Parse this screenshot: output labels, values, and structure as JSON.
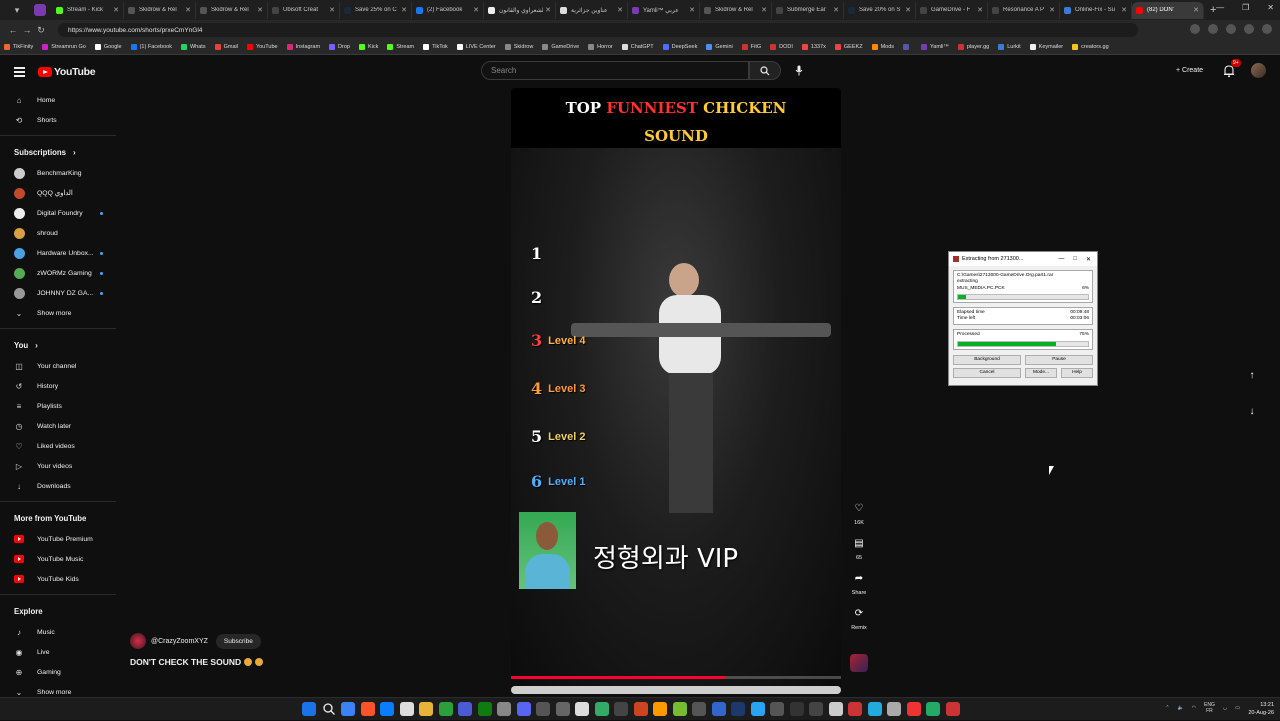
{
  "browser": {
    "tabs": [
      {
        "title": "Stream - Kick",
        "fav": "#53fc18"
      },
      {
        "title": "Skidrow & Rel",
        "fav": "#555"
      },
      {
        "title": "Skidrow & Rel",
        "fav": "#555"
      },
      {
        "title": "Ubisoft Creat",
        "fav": "#444"
      },
      {
        "title": "Save 25% on C",
        "fav": "#1b2838"
      },
      {
        "title": "(2) Facebook",
        "fav": "#1877f2"
      },
      {
        "title": "الشعراوي والقانون",
        "fav": "#eee"
      },
      {
        "title": "عناوين جزائرية",
        "fav": "#ddd"
      },
      {
        "title": "Yamli™ عربي",
        "fav": "#7a3bb0"
      },
      {
        "title": "Skidrow & Rel",
        "fav": "#555"
      },
      {
        "title": "Submerge Ear",
        "fav": "#444"
      },
      {
        "title": "Save 20% on S",
        "fav": "#1b2838"
      },
      {
        "title": "GameDrive - F",
        "fav": "#444"
      },
      {
        "title": "Resonance A P",
        "fav": "#444"
      },
      {
        "title": "Online-Fix - Su",
        "fav": "#3a7bd5"
      },
      {
        "title": "(82) DON'",
        "fav": "#ff0000",
        "active": true
      }
    ],
    "url": "https://www.youtube.com/shorts/prxeCmYnGl4",
    "bookmarks": [
      {
        "label": "TikFinity",
        "color": "#e63"
      },
      {
        "label": "Streamrun Go",
        "color": "#c2c"
      },
      {
        "label": "Google",
        "color": "#fff"
      },
      {
        "label": "(1) Facebook",
        "color": "#1877f2"
      },
      {
        "label": "Whats",
        "color": "#25d366"
      },
      {
        "label": "Gmail",
        "color": "#ea4335"
      },
      {
        "label": "YouTube",
        "color": "#f00"
      },
      {
        "label": "Instagram",
        "color": "#d62976"
      },
      {
        "label": "Drop",
        "color": "#7a5cff"
      },
      {
        "label": "Kick",
        "color": "#53fc18"
      },
      {
        "label": "Stream",
        "color": "#53fc18"
      },
      {
        "label": "TikTok",
        "color": "#fff"
      },
      {
        "label": "LIVE Center",
        "color": "#fff"
      },
      {
        "label": "Skidrow",
        "color": "#888"
      },
      {
        "label": "GameDrive",
        "color": "#888"
      },
      {
        "label": "Horror",
        "color": "#888"
      },
      {
        "label": "ChatGPT",
        "color": "#ddd"
      },
      {
        "label": "DeepSeek",
        "color": "#4d6bfe"
      },
      {
        "label": "Gemini",
        "color": "#4c8df6"
      },
      {
        "label": "FitG",
        "color": "#c33"
      },
      {
        "label": "DODI",
        "color": "#c33"
      },
      {
        "label": "1337x",
        "color": "#e44"
      },
      {
        "label": "GEEKZ",
        "color": "#e44"
      },
      {
        "label": "Mods",
        "color": "#f80"
      },
      {
        "label": "",
        "color": "#55a"
      },
      {
        "label": "Yamli™",
        "color": "#7a3bb0"
      },
      {
        "label": "player.gg",
        "color": "#c33"
      },
      {
        "label": "Lurkit",
        "color": "#3a7bd5"
      },
      {
        "label": "Keymailer",
        "color": "#eee"
      },
      {
        "label": "creators.gg",
        "color": "#f5c518"
      }
    ]
  },
  "header": {
    "logo_text": "YouTube",
    "search_placeholder": "Search",
    "create_label": "+ Create",
    "notif_badge": "9+"
  },
  "sidebar": {
    "top": [
      {
        "label": "Home",
        "icon": "home-icon",
        "glyph": "⌂"
      },
      {
        "label": "Shorts",
        "icon": "shorts-icon",
        "glyph": "⟲"
      }
    ],
    "subscriptions_title": "Subscriptions",
    "channels": [
      {
        "label": "BenchmarKing",
        "color": "#cccccc",
        "live": false
      },
      {
        "label": "QQQ الداوي",
        "color": "#c04a2a",
        "live": false
      },
      {
        "label": "Digital Foundry",
        "color": "#eeeeee",
        "live": true
      },
      {
        "label": "shroud",
        "color": "#d8a040",
        "live": false
      },
      {
        "label": "Hardware Unbox...",
        "color": "#4aa0e0",
        "live": true
      },
      {
        "label": "zWORMz Gaming",
        "color": "#5a5",
        "live": true
      },
      {
        "label": "JOHNNY DZ GA...",
        "color": "#999",
        "live": true
      }
    ],
    "show_more_1": "Show more",
    "you_title": "You",
    "you_items": [
      {
        "label": "Your channel",
        "icon": "your-channel-icon",
        "glyph": "◫"
      },
      {
        "label": "History",
        "icon": "history-icon",
        "glyph": "↺"
      },
      {
        "label": "Playlists",
        "icon": "playlists-icon",
        "glyph": "≡"
      },
      {
        "label": "Watch later",
        "icon": "watch-later-icon",
        "glyph": "◷"
      },
      {
        "label": "Liked videos",
        "icon": "liked-videos-icon",
        "glyph": "♡"
      },
      {
        "label": "Your videos",
        "icon": "your-videos-icon",
        "glyph": "▷"
      },
      {
        "label": "Downloads",
        "icon": "downloads-icon",
        "glyph": "↓"
      }
    ],
    "more_title": "More from YouTube",
    "more_items": [
      {
        "label": "YouTube Premium",
        "icon": "youtube-premium-icon"
      },
      {
        "label": "YouTube Music",
        "icon": "youtube-music-icon"
      },
      {
        "label": "YouTube Kids",
        "icon": "youtube-kids-icon"
      }
    ],
    "explore_title": "Explore",
    "explore_items": [
      {
        "label": "Music",
        "icon": "music-icon",
        "glyph": "♪"
      },
      {
        "label": "Live",
        "icon": "live-icon",
        "glyph": "◉"
      },
      {
        "label": "Gaming",
        "icon": "gaming-icon",
        "glyph": "⊕"
      }
    ],
    "show_more_2": "Show more"
  },
  "short": {
    "title_line1_a": "TOP ",
    "title_line1_b": "FUNNIEST",
    "title_line1_c": " CHICKEN",
    "title_line2": "SOUND",
    "ranks": [
      {
        "num": "1",
        "level": "",
        "num_color": "#ffffff",
        "level_color": "#ffffff"
      },
      {
        "num": "2",
        "level": "",
        "num_color": "#ffffff",
        "level_color": "#ffffff"
      },
      {
        "num": "3",
        "level": "Level 4",
        "num_color": "#ff3b3b",
        "level_color": "#ffb347"
      },
      {
        "num": "4",
        "level": "Level 3",
        "num_color": "#ff9a3b",
        "level_color": "#ff9a3b"
      },
      {
        "num": "5",
        "level": "Level 2",
        "num_color": "#ffffff",
        "level_color": "#f0d060"
      },
      {
        "num": "6",
        "level": "Level 1",
        "num_color": "#4fb0ff",
        "level_color": "#4fb0ff"
      }
    ],
    "overlay_text": "정형외과 VIP",
    "channel": "@CrazyZoomXYZ",
    "subscribe_label": "Subscribe",
    "caption": "DON'T CHECK THE SOUND",
    "progress": 0.65
  },
  "actions": [
    {
      "icon": "like-icon",
      "glyph": "♡",
      "label": "16K"
    },
    {
      "icon": "comment-icon",
      "glyph": "▤",
      "label": "65"
    },
    {
      "icon": "share-icon",
      "glyph": "➦",
      "label": "Share"
    },
    {
      "icon": "remix-icon",
      "glyph": "⟳",
      "label": "Remix"
    }
  ],
  "dialog": {
    "title": "Extracting from 271300...",
    "path": "C:\\Games\\2713000-GameDrive.Org.part1.rar",
    "status": "extracting",
    "file": "MUS_MEDIA.PC.PCK",
    "file_pct": "6%",
    "file_progress": 0.06,
    "elapsed_label": "Elapsed time",
    "elapsed": "00:09:48",
    "left_label": "Time left",
    "left": "00:03:06",
    "processed_label": "Processed",
    "processed_pct": "75%",
    "processed_progress": 0.75,
    "buttons": {
      "background": "Background",
      "pause": "Pause",
      "cancel": "Cancel",
      "mode": "Mode...",
      "help": "Help"
    }
  },
  "taskbar": {
    "apps": [
      "#1a73e8",
      "#444",
      "#3b82f6",
      "#fb542b",
      "#0a7cff",
      "#ddd",
      "#e8b339",
      "#2b9f3a",
      "#4a5bd6",
      "#107c10",
      "#888",
      "#5865f2",
      "#555",
      "#666",
      "#ddd",
      "#3a6",
      "#444",
      "#c42",
      "#f90",
      "#7b3",
      "#555",
      "#36c",
      "#1b3a6b",
      "#2aa3f0",
      "#555",
      "#333",
      "#444",
      "#ccc",
      "#c33",
      "#2ad",
      "#aaa",
      "#e33",
      "#2a6",
      "#c33"
    ],
    "lang_top": "ENG",
    "lang_bottom": "FR",
    "time": "13:21",
    "date": "20-Aug-26"
  }
}
